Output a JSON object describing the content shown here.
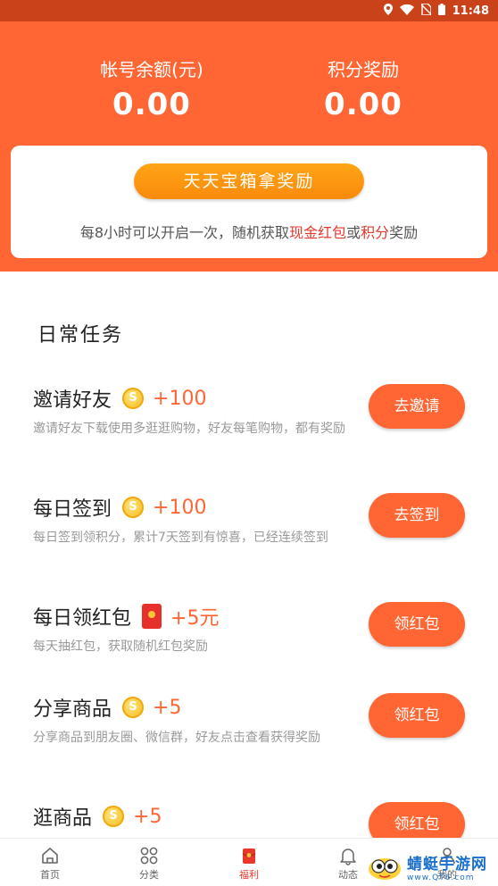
{
  "status_bar": {
    "time": "11:48",
    "icons": [
      "location-icon",
      "wifi-icon",
      "no-sim-icon",
      "battery-icon"
    ]
  },
  "header": {
    "balance_label": "帐号余额(元)",
    "balance_value": "0.00",
    "points_label": "积分奖励",
    "points_value": "0.00"
  },
  "chest": {
    "button_label": "天天宝箱拿奖励",
    "desc_prefix": "每8小时可以开启一次，随机获取",
    "desc_cash": "现金红包",
    "desc_or": "或",
    "desc_points": "积分",
    "desc_suffix": "奖励"
  },
  "section_title": "日常任务",
  "tasks": [
    {
      "title": "邀请好友",
      "icon": "coin-icon",
      "reward": "+100",
      "desc": "邀请好友下载使用多逛逛购物，好友每笔购物，都有奖励",
      "button": "去邀请"
    },
    {
      "title": "每日签到",
      "icon": "coin-icon",
      "reward": "+100",
      "desc": "每日签到领积分，累计7天签到有惊喜，已经连续签到",
      "button": "去签到"
    },
    {
      "title": "每日领红包",
      "icon": "red-packet-icon",
      "reward": "+5元",
      "desc": "每天抽红包，获取随机红包奖励",
      "button": "领红包"
    },
    {
      "title": "分享商品",
      "icon": "coin-icon",
      "reward": "+5",
      "desc": "分享商品到朋友圈、微信群，好友点击查看获得奖励",
      "button": "领红包"
    },
    {
      "title": "逛商品",
      "icon": "coin-icon",
      "reward": "+5",
      "desc": "",
      "button": "领红包"
    }
  ],
  "tabbar": {
    "items": [
      {
        "label": "首页",
        "icon": "home-icon"
      },
      {
        "label": "分类",
        "icon": "category-icon"
      },
      {
        "label": "福利",
        "icon": "gift-icon",
        "active": true
      },
      {
        "label": "动态",
        "icon": "bell-icon"
      },
      {
        "label": "我的",
        "icon": "user-icon"
      }
    ]
  },
  "watermark": {
    "name": "蜻蜓手游网",
    "url": "www.QT6.com"
  },
  "colors": {
    "primary": "#FF6633",
    "status_bar": "#C9421A",
    "chest_button": "#FFA516",
    "highlight": "#E8382C",
    "coin": "#F5B818"
  }
}
